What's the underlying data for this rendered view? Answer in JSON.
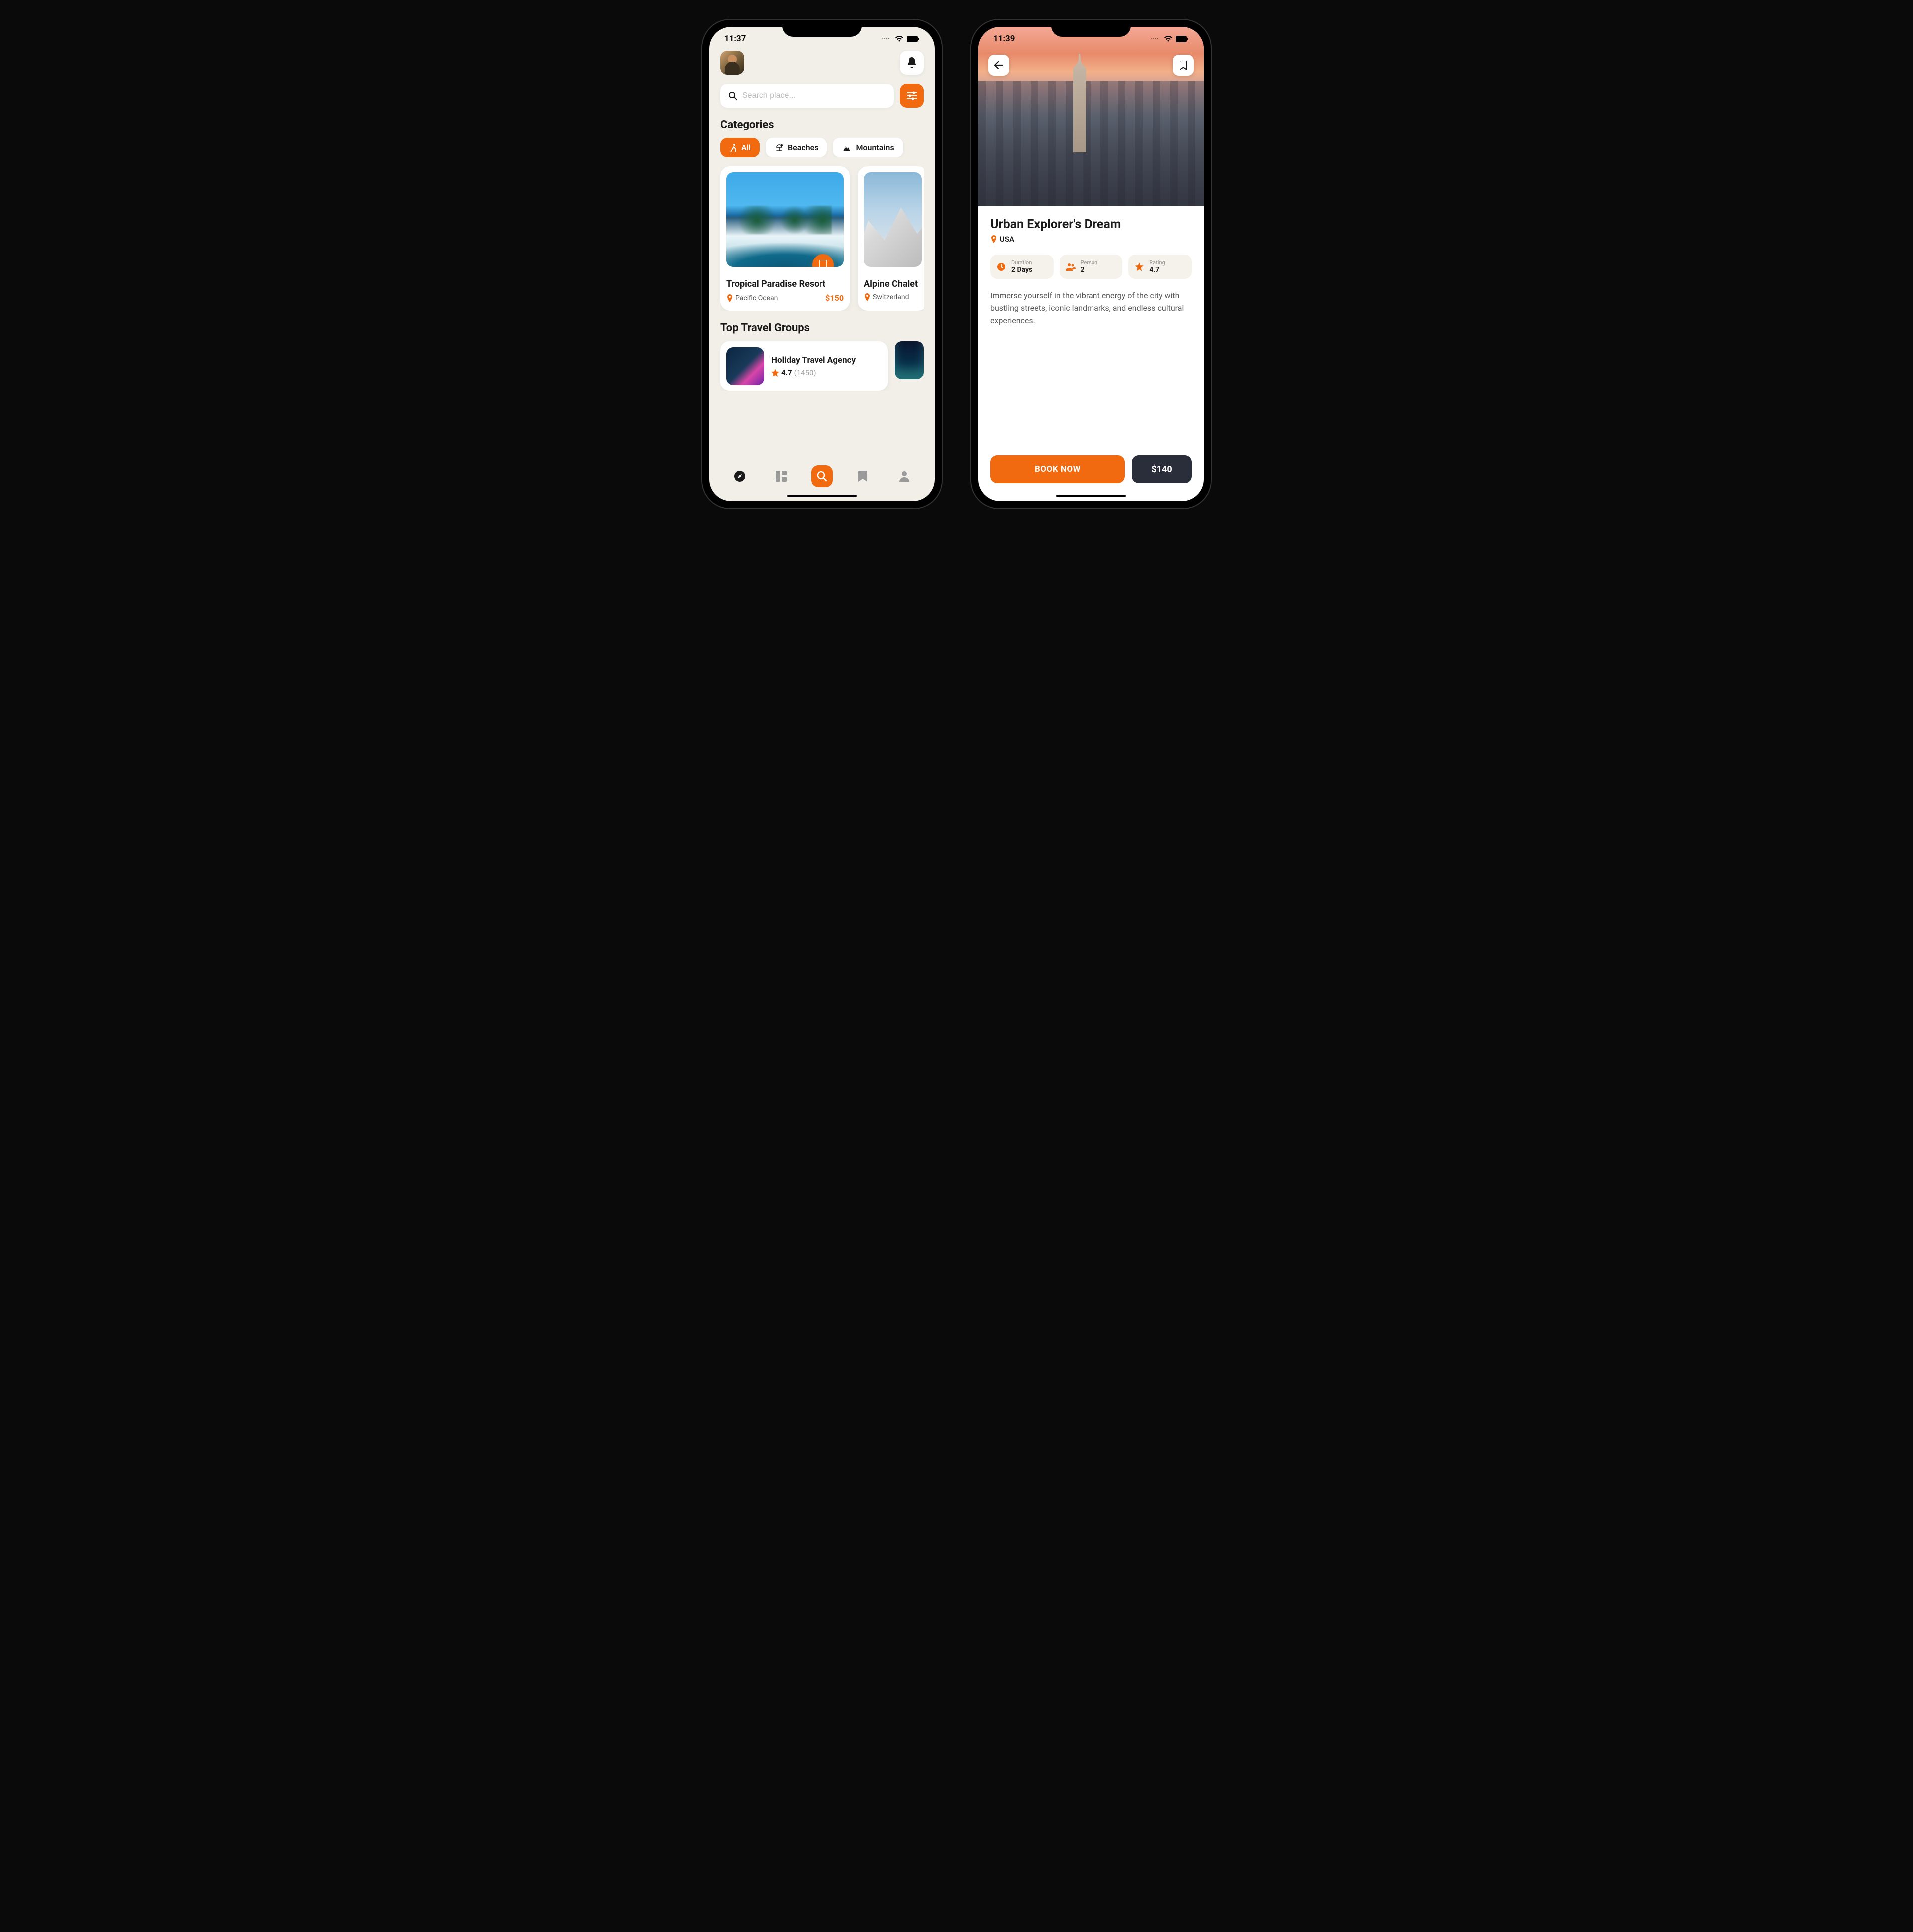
{
  "home": {
    "status_time": "11:37",
    "search_placeholder": "Search place...",
    "categories_title": "Categories",
    "chips": [
      {
        "label": "All",
        "icon": "hiker"
      },
      {
        "label": "Beaches",
        "icon": "beach"
      },
      {
        "label": "Mountains",
        "icon": "mountain"
      }
    ],
    "destinations": [
      {
        "title": "Tropical Paradise Resort",
        "location": "Pacific Ocean",
        "price": "$150"
      },
      {
        "title": "Alpine Chalet",
        "location": "Switzerland"
      }
    ],
    "groups_title": "Top Travel Groups",
    "group": {
      "name": "Holiday Travel Agency",
      "rating": "4.7",
      "reviews": "(1450)"
    }
  },
  "detail": {
    "status_time": "11:39",
    "title": "Urban Explorer's Dream",
    "location": "USA",
    "stats": {
      "duration_label": "Duration",
      "duration_value": "2 Days",
      "person_label": "Person",
      "person_value": "2",
      "rating_label": "Rating",
      "rating_value": "4.7"
    },
    "description": "Immerse yourself in the vibrant energy of the city with bustling streets, iconic landmarks, and endless cultural experiences.",
    "book_label": "BOOK NOW",
    "price": "$140"
  }
}
